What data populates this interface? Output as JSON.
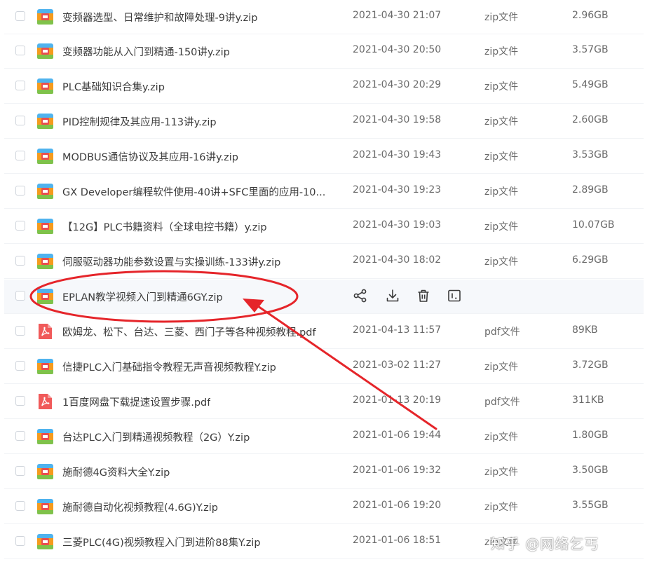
{
  "files": [
    {
      "name": "变频器选型、日常维护和故障处理-9讲y.zip",
      "date": "2021-04-30 21:07",
      "type": "zip文件",
      "size": "2.96GB",
      "icon": "zip-archive-icon"
    },
    {
      "name": "变频器功能从入门到精通-150讲y.zip",
      "date": "2021-04-30 20:50",
      "type": "zip文件",
      "size": "3.57GB",
      "icon": "zip-archive-icon"
    },
    {
      "name": "PLC基础知识合集y.zip",
      "date": "2021-04-30 20:29",
      "type": "zip文件",
      "size": "5.49GB",
      "icon": "zip-archive-icon"
    },
    {
      "name": "PID控制规律及其应用-113讲y.zip",
      "date": "2021-04-30 19:58",
      "type": "zip文件",
      "size": "2.60GB",
      "icon": "zip-archive-icon"
    },
    {
      "name": "MODBUS通信协议及其应用-16讲y.zip",
      "date": "2021-04-30 19:43",
      "type": "zip文件",
      "size": "3.53GB",
      "icon": "zip-archive-icon"
    },
    {
      "name": "GX Developer编程软件使用-40讲+SFC里面的应用-10...",
      "date": "2021-04-30 19:23",
      "type": "zip文件",
      "size": "2.89GB",
      "icon": "zip-archive-icon"
    },
    {
      "name": "【12G】PLC书籍资料（全球电控书籍）y.zip",
      "date": "2021-04-30 19:03",
      "type": "zip文件",
      "size": "10.07GB",
      "icon": "zip-archive-icon"
    },
    {
      "name": "伺服驱动器功能参数设置与实操训练-133讲y.zip",
      "date": "2021-04-30 18:02",
      "type": "zip文件",
      "size": "6.29GB",
      "icon": "zip-archive-icon"
    },
    {
      "name": "EPLAN教学视频入门到精通6GY.zip",
      "date": "",
      "type": "",
      "size": "",
      "icon": "zip-archive-icon",
      "hovered": true
    },
    {
      "name": "欧姆龙、松下、台达、三菱、西门子等各种视频教程.pdf",
      "date": "2021-04-13 11:57",
      "type": "pdf文件",
      "size": "89KB",
      "icon": "pdf-file-icon"
    },
    {
      "name": "信捷PLC入门基础指令教程无声音视频教程Y.zip",
      "date": "2021-03-02 11:27",
      "type": "zip文件",
      "size": "3.72GB",
      "icon": "zip-archive-icon"
    },
    {
      "name": "1百度网盘下载提速设置步骤.pdf",
      "date": "2021-01-13 20:19",
      "type": "pdf文件",
      "size": "311KB",
      "icon": "pdf-file-icon"
    },
    {
      "name": "台达PLC入门到精通视频教程（2G）Y.zip",
      "date": "2021-01-06 19:44",
      "type": "zip文件",
      "size": "1.80GB",
      "icon": "zip-archive-icon"
    },
    {
      "name": "施耐德4G资料大全Y.zip",
      "date": "2021-01-06 19:32",
      "type": "zip文件",
      "size": "3.50GB",
      "icon": "zip-archive-icon"
    },
    {
      "name": "施耐德自动化视频教程(4.6G)Y.zip",
      "date": "2021-01-06 19:20",
      "type": "zip文件",
      "size": "3.55GB",
      "icon": "zip-archive-icon"
    },
    {
      "name": "三菱PLC(4G)视频教程入门到进阶88集Y.zip",
      "date": "2021-01-06 18:51",
      "type": "zip文件",
      "size": "",
      "icon": "zip-archive-icon"
    }
  ],
  "hover_actions": [
    {
      "name": "share-icon"
    },
    {
      "name": "download-icon"
    },
    {
      "name": "delete-icon"
    },
    {
      "name": "rename-icon"
    }
  ],
  "annotation": {
    "color": "#e5252a"
  },
  "watermark": "知乎 @网络乞丐",
  "colors": {
    "hover_row": "#f6f8fb",
    "zip_icon": "#4fb3ee",
    "pdf_icon": "#f05a5a"
  }
}
